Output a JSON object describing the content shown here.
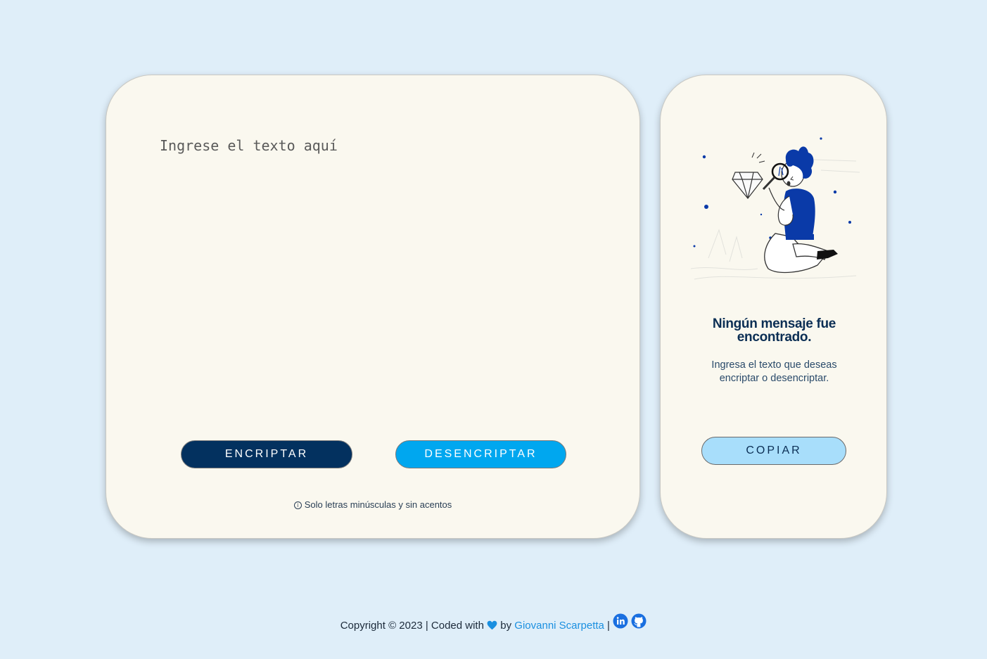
{
  "input": {
    "placeholder": "Ingrese el texto aquí"
  },
  "buttons": {
    "encrypt_label": "ENCRIPTAR",
    "decrypt_label": "DESENCRIPTAR",
    "copy_label": "COPIAR"
  },
  "hint": {
    "icon": "info-icon",
    "text": "Solo letras minúsculas y sin acentos"
  },
  "output": {
    "title": "Ningún mensaje fue encontrado.",
    "description": "Ingresa el texto que deseas encriptar o desencriptar."
  },
  "footer": {
    "prefix": "Copyright © 2023 | Coded with",
    "by": "by",
    "author": "Giovanni Scarpetta",
    "separator": "|",
    "icons": [
      "heart-icon",
      "linkedin-icon",
      "github-icon"
    ]
  },
  "colors": {
    "background": "#dfeef9",
    "card": "#faf8ef",
    "encrypt_button": "#03315f",
    "decrypt_button": "#00a7ef",
    "copy_button": "#a8defb",
    "accent_link": "#1a8fe0",
    "illustration_blue": "#0a3aa8"
  }
}
